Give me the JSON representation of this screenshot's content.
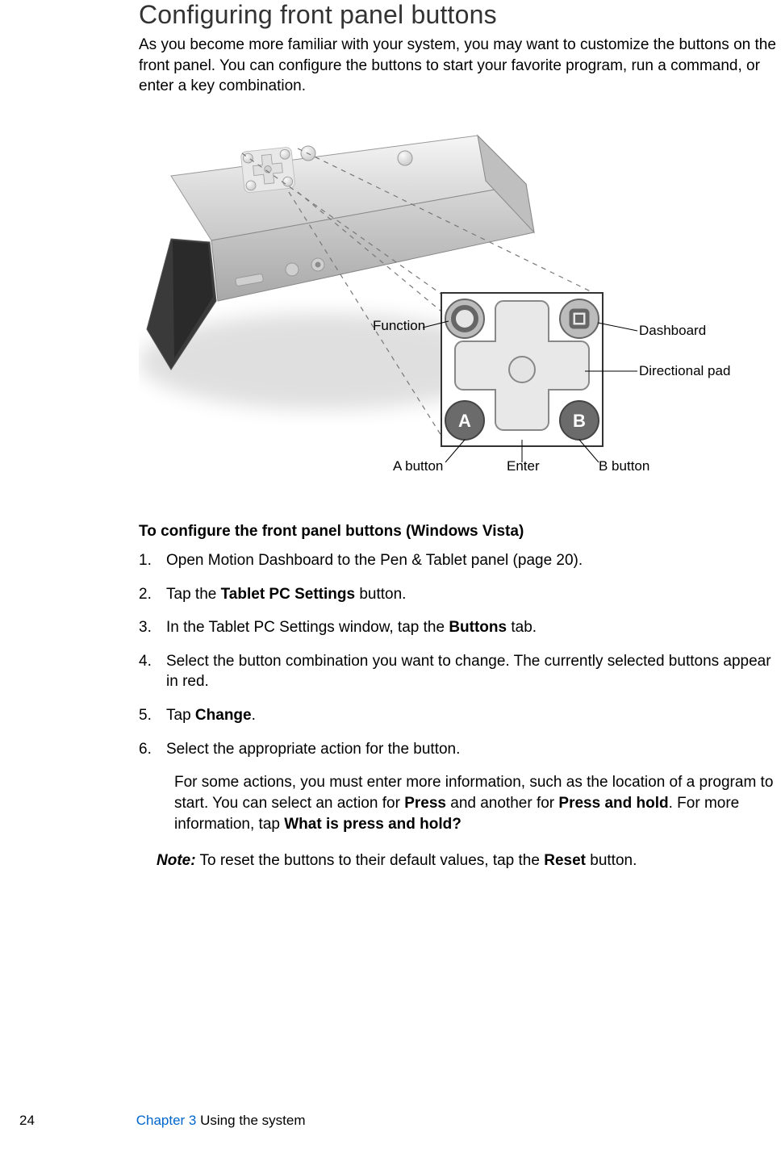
{
  "heading": "Configuring front panel buttons",
  "intro": "As you become more familiar with your system, you may want to customize the buttons on the front panel. You can configure the buttons to start your favorite program, run a command, or enter a key combination.",
  "callouts": {
    "function": "Function",
    "dashboard": "Dashboard",
    "directional_pad": "Directional pad",
    "a_button": "A button",
    "enter": "Enter",
    "b_button": "B button",
    "a_letter": "A",
    "b_letter": "B"
  },
  "instruct_head": "To configure the front panel buttons (Windows Vista)",
  "steps": {
    "s1": "Open Motion Dashboard to the Pen & Tablet panel (page 20).",
    "s2_pre": "Tap the ",
    "s2_bold": "Tablet PC Settings",
    "s2_post": " button.",
    "s3_pre": "In the Tablet PC Settings window, tap the ",
    "s3_bold": "Buttons",
    "s3_post": " tab.",
    "s4": "Select the button combination you want to change. The currently selected buttons appear in red.",
    "s5_pre": "Tap ",
    "s5_bold": "Change",
    "s5_post": ".",
    "s6": "Select the appropriate action for the button."
  },
  "sub_para_pre": "For some actions, you must enter more information, such as the location of a program to start. You can select an action for ",
  "sub_para_b1": "Press",
  "sub_para_mid": " and another for ",
  "sub_para_b2": "Press and hold",
  "sub_para_post": ". For more information, tap ",
  "sub_para_b3": "What is press and hold?",
  "note_label": "Note:",
  "note_pre": " To reset the buttons to their default values, tap the ",
  "note_bold": "Reset",
  "note_post": " button.",
  "footer": {
    "page": "24",
    "chapter": "Chapter 3",
    "chapter_title": "  Using the system"
  }
}
